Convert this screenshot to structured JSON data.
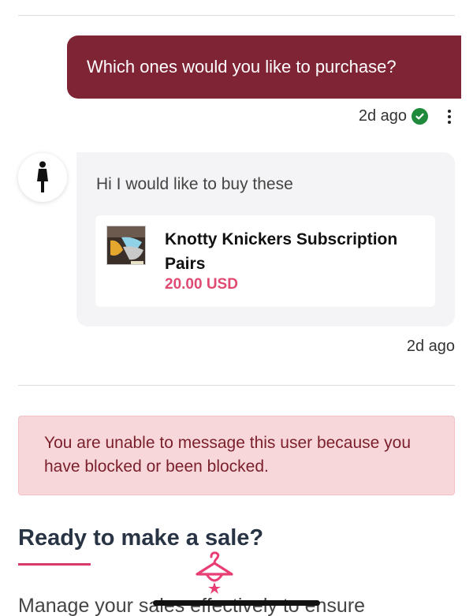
{
  "outgoing_message": {
    "text": "Which ones would you like to purchase?",
    "timestamp": "2d ago",
    "status_icon": "check-circle-icon",
    "menu_icon": "kebab-menu-icon"
  },
  "incoming_message": {
    "avatar_icon": "user-silhouette-icon",
    "text": "Hi I would like to buy these",
    "product": {
      "name": "Knotty Knickers Subscription Pairs",
      "price": "20.00 USD"
    },
    "timestamp": "2d ago"
  },
  "blocked_notice": {
    "text": "You are unable to message this user because you have blocked or been blocked."
  },
  "promo": {
    "title": "Ready to make a sale?",
    "body": "Manage your sales effectively to ensure"
  },
  "colors": {
    "outgoing_bubble": "#7f2435",
    "price": "#e04a72",
    "blocked_bg": "#f8d7da",
    "blocked_text": "#7a1f2b",
    "accent": "#d93a6a",
    "check": "#1f8a3b"
  }
}
